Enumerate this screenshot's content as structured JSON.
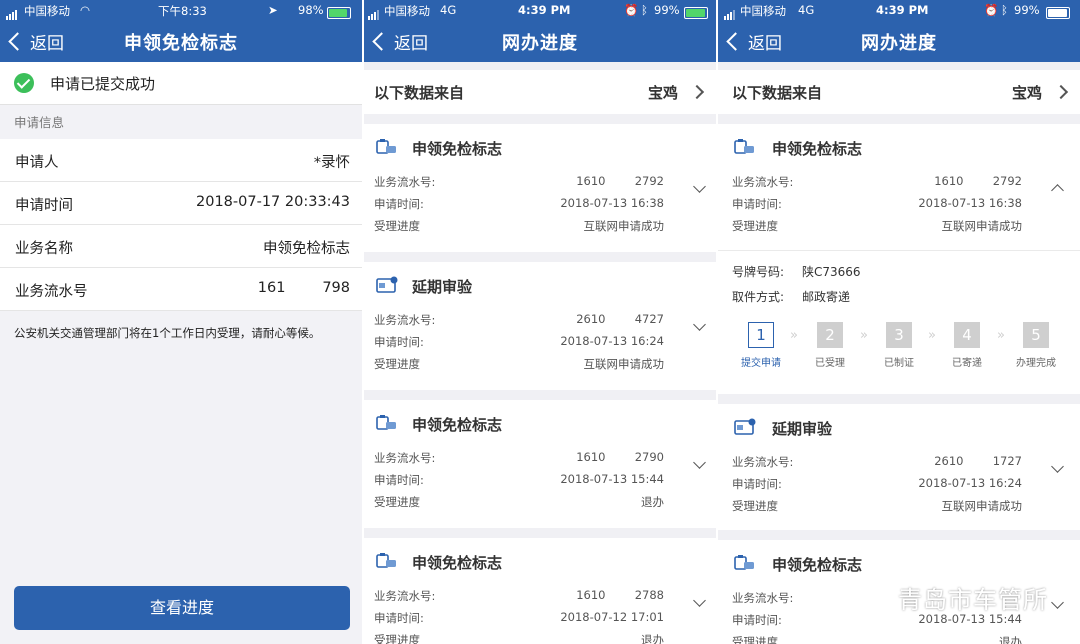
{
  "screen1": {
    "status": {
      "carrier": "中国移动",
      "time": "下午8:33",
      "battery": "98%"
    },
    "nav": {
      "back": "返回",
      "title": "申领免检标志"
    },
    "success_text": "申请已提交成功",
    "section": "申请信息",
    "rows": [
      {
        "label": "申请人",
        "value": "*录怀"
      },
      {
        "label": "申请时间",
        "value": "2018-07-17 20:33:43"
      },
      {
        "label": "业务名称",
        "value": "申领免检标志"
      },
      {
        "label": "业务流水号",
        "value": "161        798"
      }
    ],
    "notice": "公安机关交通管理部门将在1个工作日内受理，请耐心等候。",
    "button": "查看进度",
    "colors": {
      "nav": "#2c62ae",
      "success": "#3cbf5a"
    }
  },
  "screen2": {
    "status": {
      "carrier": "中国移动",
      "network": "4G",
      "time": "4:39 PM",
      "battery": "99%"
    },
    "nav": {
      "back": "返回",
      "title": "网办进度"
    },
    "source": {
      "label": "以下数据来自",
      "city": "宝鸡"
    },
    "cards": [
      {
        "title": "申领免检标志",
        "icon": "inspection-icon",
        "serial_label": "业务流水号:",
        "serial": "1610        2792",
        "time_label": "申请时间:",
        "time": "2018-07-13 16:38",
        "progress_label": "受理进度",
        "progress": "互联网申请成功"
      },
      {
        "title": "延期审验",
        "icon": "card-icon",
        "serial_label": "业务流水号:",
        "serial": "2610        4727",
        "time_label": "申请时间:",
        "time": "2018-07-13 16:24",
        "progress_label": "受理进度",
        "progress": "互联网申请成功"
      },
      {
        "title": "申领免检标志",
        "icon": "inspection-icon",
        "serial_label": "业务流水号:",
        "serial": "1610        2790",
        "time_label": "申请时间:",
        "time": "2018-07-13 15:44",
        "progress_label": "受理进度",
        "progress": "退办"
      },
      {
        "title": "申领免检标志",
        "icon": "inspection-icon",
        "serial_label": "业务流水号:",
        "serial": "1610        2788",
        "time_label": "申请时间:",
        "time": "2018-07-12 17:01",
        "progress_label": "受理进度",
        "progress": "退办"
      }
    ]
  },
  "screen3": {
    "status": {
      "carrier": "中国移动",
      "network": "4G",
      "time": "4:39 PM",
      "battery": "99%"
    },
    "nav": {
      "back": "返回",
      "title": "网办进度"
    },
    "source": {
      "label": "以下数据来自",
      "city": "宝鸡"
    },
    "card1": {
      "title": "申领免检标志",
      "serial_label": "业务流水号:",
      "serial": "1610        2792",
      "time_label": "申请时间:",
      "time": "2018-07-13 16:38",
      "progress_label": "受理进度",
      "progress": "互联网申请成功",
      "plate_label": "号牌号码:",
      "plate": "陕C73666",
      "pickup_label": "取件方式:",
      "pickup": "邮政寄递"
    },
    "steps": [
      {
        "num": "1",
        "label": "提交申请",
        "active": true
      },
      {
        "num": "2",
        "label": "已受理",
        "active": false
      },
      {
        "num": "3",
        "label": "已制证",
        "active": false
      },
      {
        "num": "4",
        "label": "已寄递",
        "active": false
      },
      {
        "num": "5",
        "label": "办理完成",
        "active": false
      }
    ],
    "card2": {
      "title": "延期审验",
      "serial_label": "业务流水号:",
      "serial": "2610        1727",
      "time_label": "申请时间:",
      "time": "2018-07-13 16:24",
      "progress_label": "受理进度",
      "progress": "互联网申请成功"
    },
    "card3": {
      "title": "申领免检标志",
      "serial_label": "业务流水号:",
      "time_label": "申请时间:",
      "time": "2018-07-13 15:44",
      "progress_label": "受理进度",
      "progress": "退办"
    }
  },
  "watermark": "青岛市车管所"
}
